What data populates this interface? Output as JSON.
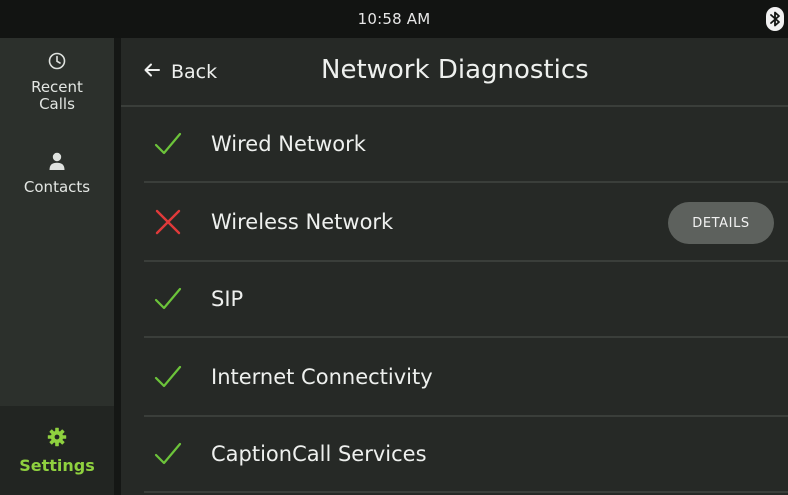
{
  "status_bar": {
    "time": "10:58 AM",
    "bluetooth_icon": "bluetooth-icon"
  },
  "sidebar": {
    "items": [
      {
        "label": "Recent Calls",
        "icon": "clock-icon",
        "active": false
      },
      {
        "label": "Contacts",
        "icon": "person-icon",
        "active": false
      },
      {
        "label": "Settings",
        "icon": "gear-icon",
        "active": true
      }
    ]
  },
  "header": {
    "back_label": "Back",
    "title": "Network Diagnostics"
  },
  "diagnostics": [
    {
      "label": "Wired Network",
      "status": "pass"
    },
    {
      "label": "Wireless Network",
      "status": "fail",
      "action": "DETAILS"
    },
    {
      "label": "SIP",
      "status": "pass"
    },
    {
      "label": "Internet Connectivity",
      "status": "pass"
    },
    {
      "label": "CaptionCall Services",
      "status": "pass"
    }
  ],
  "colors": {
    "pass": "#6cc43a",
    "fail": "#e03a3a",
    "active_nav": "#8fd13f"
  }
}
